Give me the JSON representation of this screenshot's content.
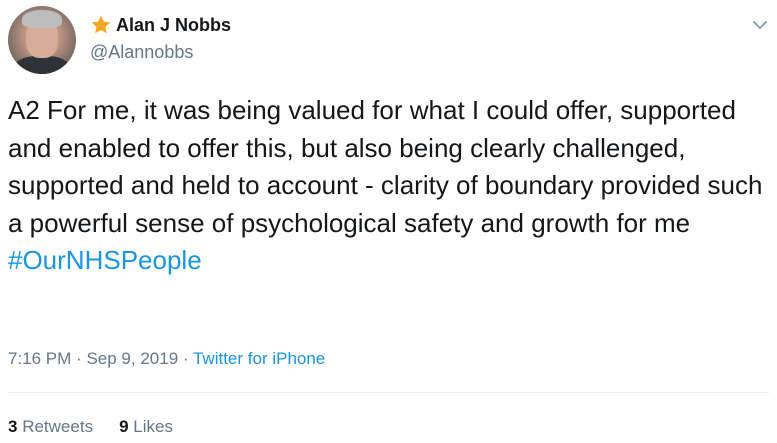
{
  "user": {
    "display_name": "Alan J Nobbs",
    "handle": "@Alannobbs",
    "avatar_icon": "profile-photo",
    "badge_icon": "star-icon",
    "badge_color": "#f5a623"
  },
  "tweet": {
    "text": "A2 For me, it was being valued for what I could offer, supported and enabled to offer this, but also being clearly challenged, supported and held to account - clarity of boundary provided such a powerful sense of psychological safety and growth for me",
    "hashtag": "#OurNHSPeople",
    "time": "7:16 PM",
    "separator": "·",
    "date": "Sep 9, 2019",
    "source": "Twitter for iPhone"
  },
  "stats": {
    "retweets_count": "3",
    "retweets_label": "Retweets",
    "likes_count": "9",
    "likes_label": "Likes"
  },
  "colors": {
    "link": "#1b95e0",
    "secondary_text": "#657786",
    "primary_text": "#14171a"
  }
}
